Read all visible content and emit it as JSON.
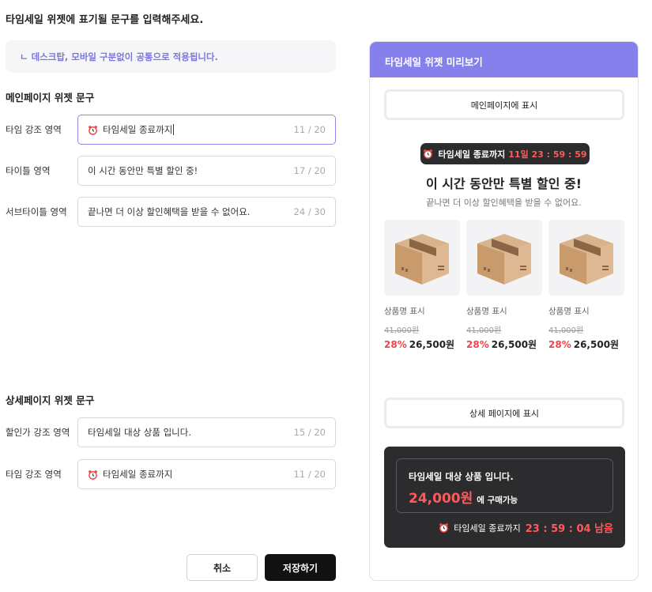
{
  "page": {
    "title": "타임세일 위젯에 표기될 문구를 입력해주세요.",
    "notice": "ㄴ 데스크탑, 모바일 구분없이 공통으로 적용됩니다."
  },
  "main_section": {
    "title": "메인페이지 위젯 문구",
    "fields": [
      {
        "label": "타임 강조 영역",
        "value": "타임세일 종료까지",
        "count": "11 / 20",
        "icon": "alarm-clock-icon"
      },
      {
        "label": "타이틀 영역",
        "value": "이 시간 동안만 특별 할인 중!",
        "count": "17 / 20"
      },
      {
        "label": "서브타이틀 영역",
        "value": "끝나면 더 이상 할인혜택을 받을 수 없어요.",
        "count": "24 / 30"
      }
    ]
  },
  "detail_section": {
    "title": "상세페이지 위젯 문구",
    "fields": [
      {
        "label": "할인가 강조 영역",
        "value": "타임세일 대상 상품 입니다.",
        "count": "15 / 20"
      },
      {
        "label": "타임 강조 영역",
        "value": "타임세일 종료까지",
        "count": "11 / 20",
        "icon": "alarm-clock-icon"
      }
    ]
  },
  "actions": {
    "cancel": "취소",
    "save": "저장하기"
  },
  "preview": {
    "header": "타임세일 위젯 미리보기",
    "main_tab": "메인페이지에 표시",
    "timer_text": "타임세일 종료까지",
    "timer_value": "11일 23 : 59 : 59",
    "headline": "이 시간 동안만 특별 할인 중!",
    "subline": "끝나면 더 이상 할인혜택을 받을 수 없어요.",
    "products": [
      {
        "name": "상품명 표시",
        "original": "41,000원",
        "discount": "28%",
        "price": "26,500원",
        "icon": "box-icon"
      },
      {
        "name": "상품명 표시",
        "original": "41,000원",
        "discount": "28%",
        "price": "26,500원",
        "icon": "box-icon"
      },
      {
        "name": "상품명 표시",
        "original": "41,000원",
        "discount": "28%",
        "price": "26,500원",
        "icon": "box-icon"
      }
    ],
    "detail_tab": "상세 페이지에 표시",
    "detail": {
      "title": "타임세일 대상 상품 입니다.",
      "amount": "24,000원",
      "buy_text": "에 구매가능",
      "timer_text": "타임세일 종료까지",
      "timer_value": "23 : 59 : 04 남음"
    }
  },
  "colors": {
    "accent": "#8680ec",
    "notice_text": "#7b77d9",
    "sale_red": "#f2454b",
    "dark": "#2c2c2e"
  }
}
